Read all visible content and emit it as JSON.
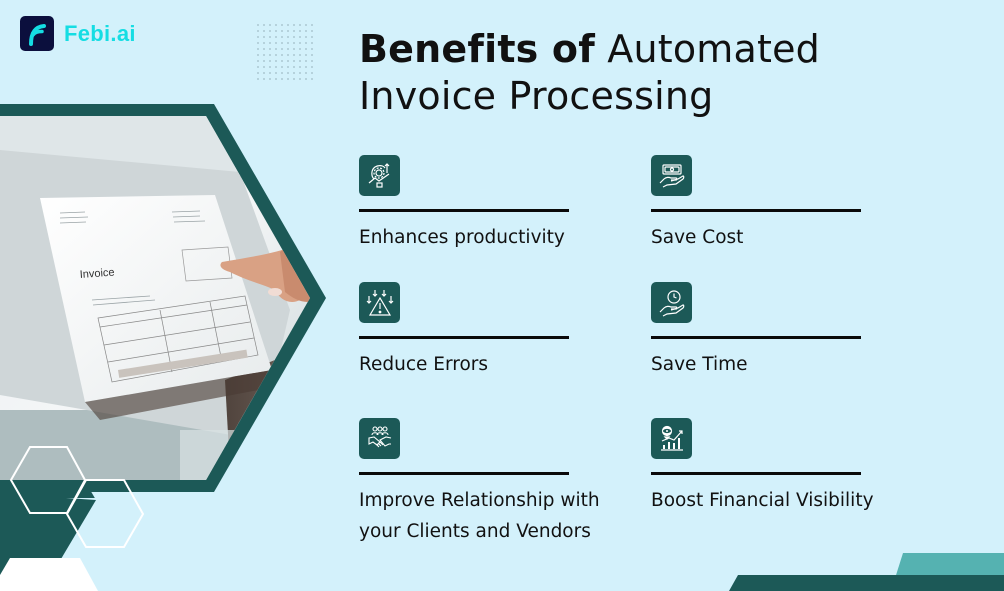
{
  "brand": {
    "name": "Febi.ai",
    "logo_icon": "febi-logo-icon",
    "color": "#15dde3"
  },
  "title": {
    "bold_part": "Benefits of",
    "regular_part_line1": "Automated",
    "regular_part_line2": "Invoice Processing"
  },
  "hero_image": {
    "description": "Person pointing at invoice on laptop screen",
    "invoice_heading": "Invoice"
  },
  "benefits": [
    {
      "label": "Enhances productivity",
      "icon": "productivity-lightbulb-gear-icon"
    },
    {
      "label": "Save Cost",
      "icon": "money-in-hand-icon"
    },
    {
      "label": "Reduce Errors",
      "icon": "warning-triangle-arrows-icon"
    },
    {
      "label": "Save Time",
      "icon": "clock-in-hand-icon"
    },
    {
      "label": "Improve Relationship with your Clients and Vendors",
      "icon": "handshake-people-icon"
    },
    {
      "label": "Boost Financial Visibility",
      "icon": "growth-chart-eye-icon"
    }
  ],
  "colors": {
    "background": "#d3f1fb",
    "dark_teal": "#1c5957",
    "light_teal": "#55b2b1",
    "logo_bg": "#0b0f3d"
  }
}
